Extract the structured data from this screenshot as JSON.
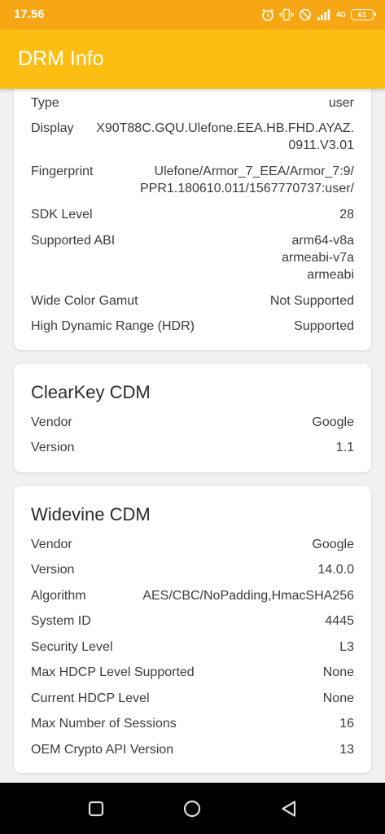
{
  "status_bar": {
    "time": "17.56",
    "network": "4G",
    "battery": "61"
  },
  "app_bar": {
    "title": "DRM Info"
  },
  "device_card": {
    "rows": [
      {
        "label": "Type",
        "value": [
          "user"
        ]
      },
      {
        "label": "Display",
        "value": [
          "X90T88C.GQU.Ulefone.EEA.HB.FHD.AYAZ.",
          "0911.V3.01"
        ]
      },
      {
        "label": "Fingerprint",
        "value": [
          "Ulefone/Armor_7_EEA/Armor_7:9/",
          "PPR1.180610.011/1567770737:user/"
        ]
      },
      {
        "label": "SDK Level",
        "value": [
          "28"
        ]
      },
      {
        "label": "Supported ABI",
        "value": [
          "arm64-v8a",
          "armeabi-v7a",
          "armeabi"
        ]
      },
      {
        "label": "Wide Color Gamut",
        "value": [
          "Not Supported"
        ]
      },
      {
        "label": "High Dynamic Range (HDR)",
        "value": [
          "Supported"
        ]
      }
    ]
  },
  "clearkey_card": {
    "title": "ClearKey CDM",
    "rows": [
      {
        "label": "Vendor",
        "value": [
          "Google"
        ]
      },
      {
        "label": "Version",
        "value": [
          "1.1"
        ]
      }
    ]
  },
  "widevine_card": {
    "title": "Widevine CDM",
    "rows": [
      {
        "label": "Vendor",
        "value": [
          "Google"
        ]
      },
      {
        "label": "Version",
        "value": [
          "14.0.0"
        ]
      },
      {
        "label": "Algorithm",
        "value": [
          "AES/CBC/NoPadding,HmacSHA256"
        ]
      },
      {
        "label": "System ID",
        "value": [
          "4445"
        ]
      },
      {
        "label": "Security Level",
        "value": [
          "L3"
        ]
      },
      {
        "label": "Max HDCP Level Supported",
        "value": [
          "None"
        ]
      },
      {
        "label": "Current HDCP Level",
        "value": [
          "None"
        ]
      },
      {
        "label": "Max Number of Sessions",
        "value": [
          "16"
        ]
      },
      {
        "label": "OEM Crypto API Version",
        "value": [
          "13"
        ]
      }
    ]
  },
  "nav_bar": {
    "icons": [
      "recents-icon",
      "home-icon",
      "back-icon"
    ]
  }
}
